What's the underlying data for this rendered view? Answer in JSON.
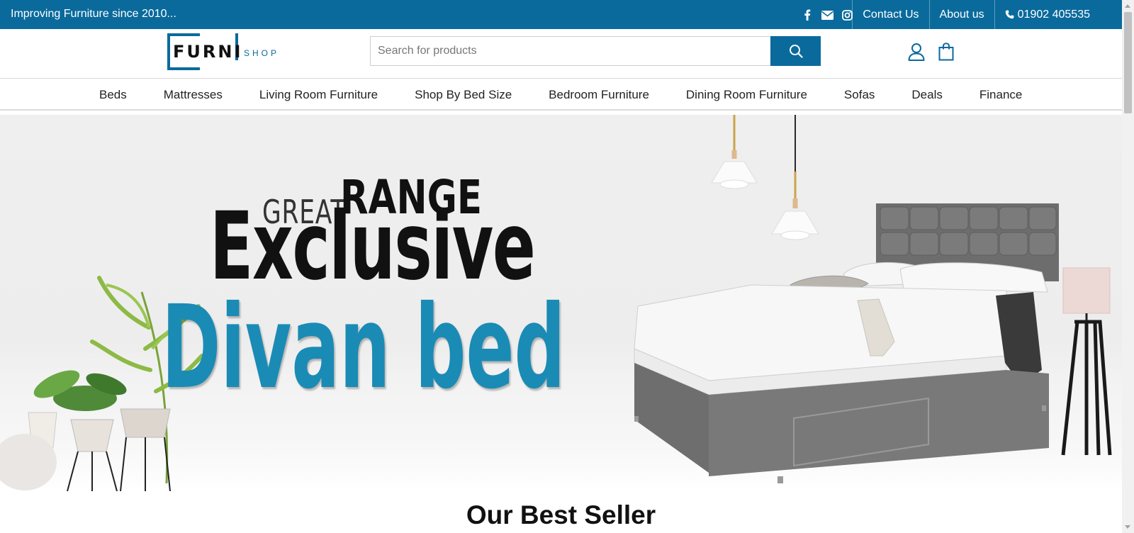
{
  "topbar": {
    "tagline": "Improving Furniture since 2010...",
    "social": [
      "facebook-icon",
      "envelope-icon",
      "instagram-icon"
    ],
    "links": {
      "contact": "Contact Us",
      "about": "About us",
      "phone": "01902 405535"
    }
  },
  "header": {
    "logo_main": "FURNI",
    "logo_sub": "SHOP",
    "search_placeholder": "Search for products",
    "icons": [
      "user-icon",
      "shopping-bag-icon"
    ]
  },
  "nav": {
    "items": [
      "Beds",
      "Mattresses",
      "Living Room Furniture",
      "Shop By Bed Size",
      "Bedroom Furniture",
      "Dining Room Furniture",
      "Sofas",
      "Deals",
      "Finance"
    ]
  },
  "hero": {
    "great": "GREAT",
    "range": "RANGE",
    "exclusive": "Exclusive",
    "divan": "Divan bed"
  },
  "section": {
    "title": "Our Best Seller"
  },
  "colors": {
    "brand": "#0a6a9c",
    "hero_accent": "#1a8bb5"
  }
}
